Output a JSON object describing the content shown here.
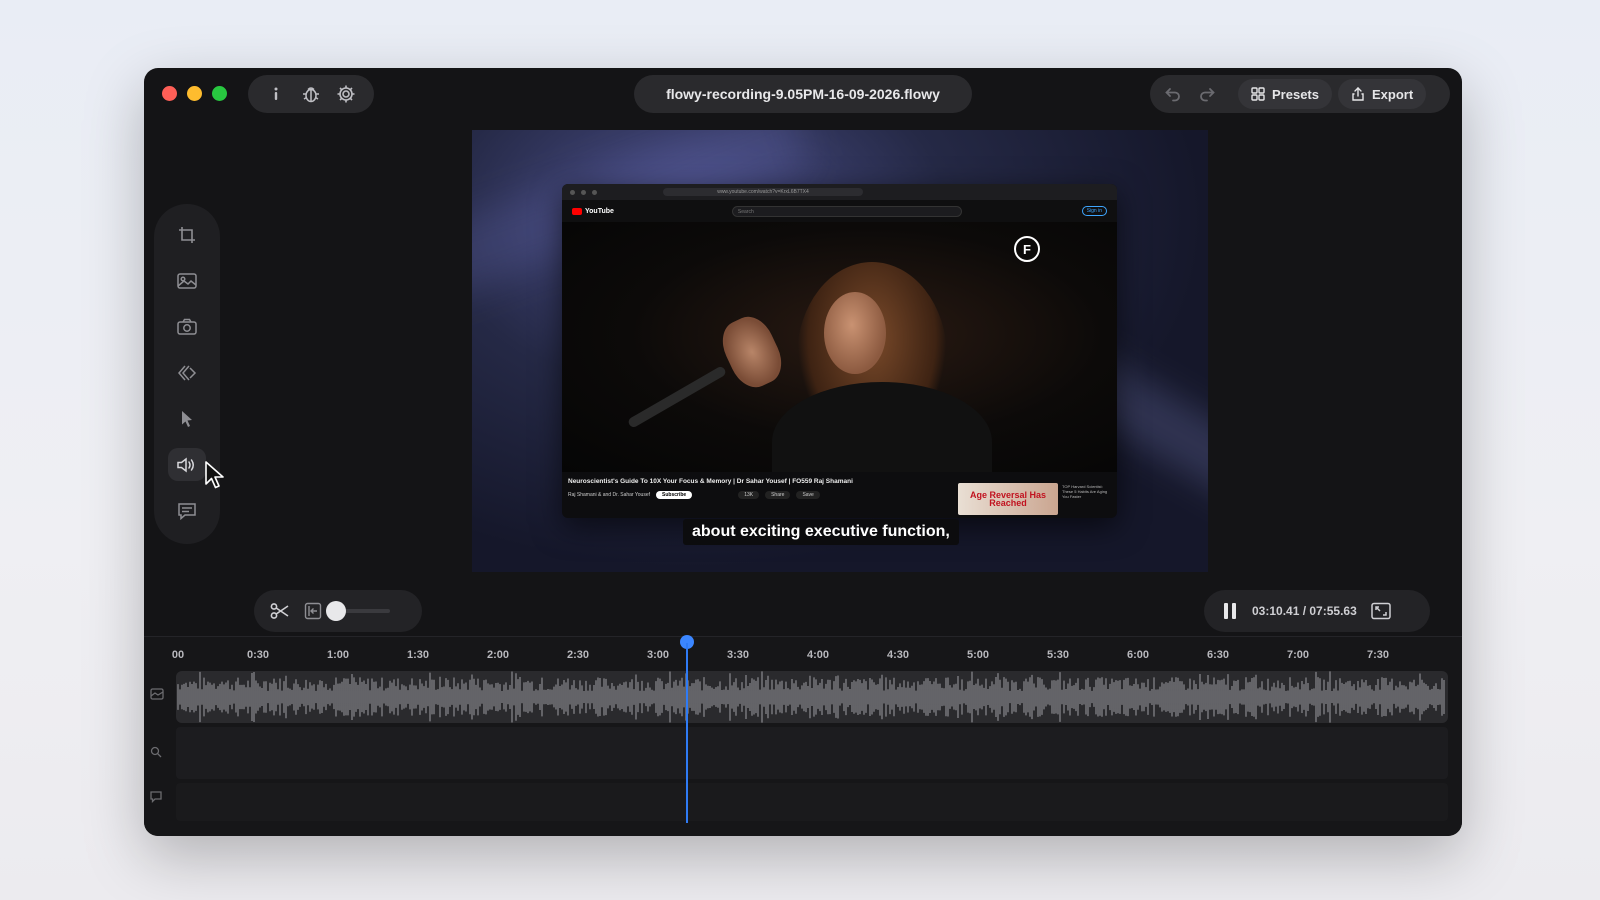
{
  "window": {
    "title": "flowy-recording-9.05PM-16-09-2026.flowy"
  },
  "toolbar": {
    "info_icon": "info-icon",
    "bug_icon": "bug-icon",
    "settings_icon": "gear-icon",
    "presets_label": "Presets",
    "export_label": "Export"
  },
  "preview": {
    "browser_url": "www.youtube.com/watch?v=KrxL6B7TX4",
    "youtube_label": "YouTube",
    "search_placeholder": "Search",
    "sign_in": "Sign in",
    "video_title": "Neuroscientist's Guide To 10X Your Focus & Memory | Dr Sahar Yousef | FO559 Raj Shamani",
    "channel": "Raj Shamani & and Dr. Sahar Yousef",
    "subscribe": "Subscribe",
    "likes": "13K",
    "share": "Share",
    "save": "Save",
    "ad_text": "Age Reversal Has Reached",
    "ad_side_text": "TOP Harvard Scientist: These 5 Habits Are Aging You Faster",
    "logo_letter": "F",
    "caption": "about exciting executive function,"
  },
  "sidebar_tools": [
    {
      "name": "crop-icon"
    },
    {
      "name": "image-icon"
    },
    {
      "name": "camera-icon"
    },
    {
      "name": "zoom-effect-icon"
    },
    {
      "name": "cursor-icon"
    },
    {
      "name": "audio-icon"
    },
    {
      "name": "caption-icon"
    }
  ],
  "editor": {
    "zoom_level": 0
  },
  "playback": {
    "time": "03:10.41 / 07:55.63",
    "current_seconds": 190.41,
    "total_seconds": 475.63
  },
  "timeline": {
    "ticks": [
      "00",
      "0:30",
      "1:00",
      "1:30",
      "2:00",
      "2:30",
      "3:00",
      "3:30",
      "4:00",
      "4:30",
      "5:00",
      "5:30",
      "6:00",
      "6:30",
      "7:00",
      "7:30"
    ],
    "tick_seconds": [
      0,
      30,
      60,
      90,
      120,
      150,
      180,
      210,
      240,
      270,
      300,
      330,
      360,
      390,
      420,
      450
    ]
  },
  "colors": {
    "accent": "#3b86ff",
    "close": "#fe5f57",
    "minimize": "#febc2e",
    "maximize": "#28c840"
  }
}
